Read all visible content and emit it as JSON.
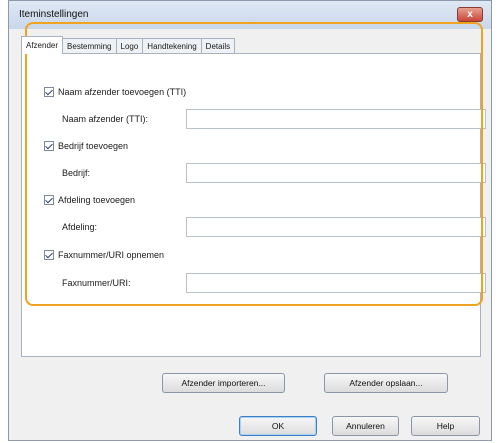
{
  "window": {
    "title": "Iteminstellingen",
    "close_label": "x"
  },
  "tabs": [
    "Afzender",
    "Bestemming",
    "Logo",
    "Handtekening",
    "Details"
  ],
  "fields": [
    {
      "checkbox_label": "Naam afzender toevoegen (TTI)",
      "field_label": "Naam afzender (TTI):",
      "value": "",
      "checked": true
    },
    {
      "checkbox_label": "Bedrijf toevoegen",
      "field_label": "Bedrijf:",
      "value": "",
      "checked": true
    },
    {
      "checkbox_label": "Afdeling toevoegen",
      "field_label": "Afdeling:",
      "value": "",
      "checked": true
    },
    {
      "checkbox_label": "Faxnummer/URI opnemen",
      "field_label": "Faxnummer/URI:",
      "value": "",
      "checked": true
    }
  ],
  "buttons": {
    "import": "Afzender importeren...",
    "save": "Afzender opslaan...",
    "ok": "OK",
    "cancel": "Annuleren",
    "help": "Help"
  },
  "colors": {
    "highlight": "#f0a320"
  }
}
